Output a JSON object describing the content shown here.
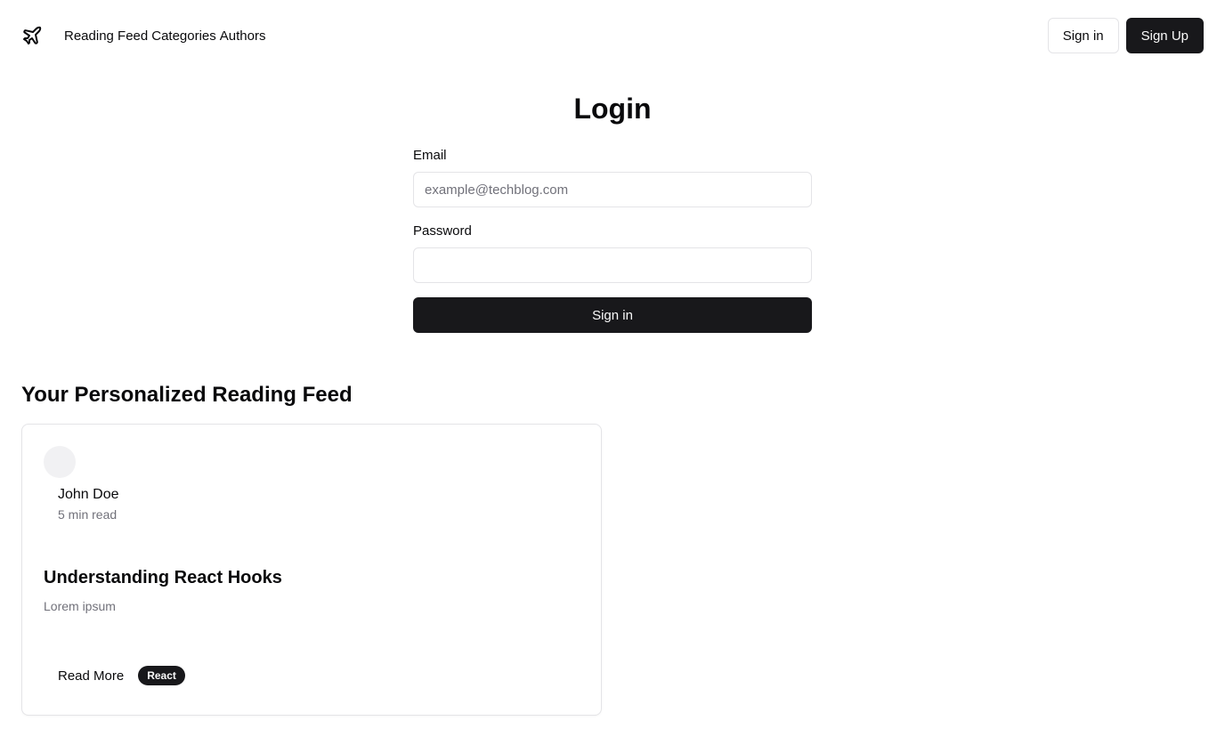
{
  "header": {
    "logo_icon": "plane-icon",
    "nav": [
      {
        "label": "Reading Feed"
      },
      {
        "label": "Categories"
      },
      {
        "label": "Authors"
      }
    ],
    "sign_in_label": "Sign in",
    "sign_up_label": "Sign Up"
  },
  "login": {
    "title": "Login",
    "email_label": "Email",
    "email_placeholder": "example@techblog.com",
    "email_value": "",
    "password_label": "Password",
    "password_value": "",
    "submit_label": "Sign in"
  },
  "feed": {
    "title": "Your Personalized Reading Feed",
    "posts": [
      {
        "author": "John Doe",
        "read_time": "5 min read",
        "title": "Understanding React Hooks",
        "excerpt": "Lorem ipsum",
        "read_more_label": "Read More",
        "tag": "React"
      }
    ]
  },
  "colors": {
    "primary": "#18181b",
    "border": "#e4e4e7",
    "muted_text": "#71717a"
  }
}
